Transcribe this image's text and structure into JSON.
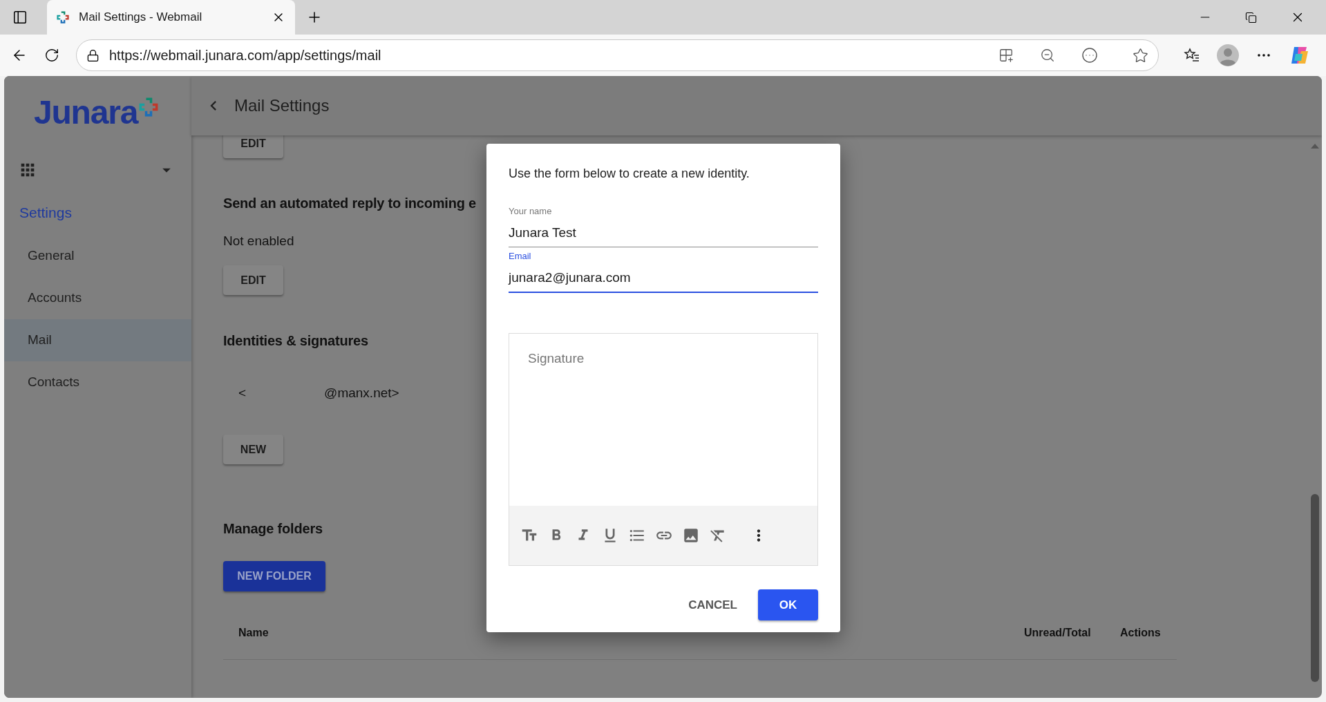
{
  "browser": {
    "tab_title": "Mail Settings - Webmail",
    "url": "https://webmail.junara.com/app/settings/mail"
  },
  "sidebar": {
    "logo": "Junara",
    "section": "Settings",
    "items": [
      {
        "label": "General",
        "selected": false
      },
      {
        "label": "Accounts",
        "selected": false
      },
      {
        "label": "Mail",
        "selected": true
      },
      {
        "label": "Contacts",
        "selected": false
      }
    ]
  },
  "header": {
    "title": "Mail Settings"
  },
  "content": {
    "top_button": "EDIT",
    "auto_reply_heading": "Send an automated reply to incoming e",
    "auto_reply_status": "Not enabled",
    "auto_reply_button": "EDIT",
    "identities_heading": "Identities & signatures",
    "identity_open": "<",
    "identity_address": "@manx.net>",
    "new_button": "NEW",
    "folders_heading": "Manage folders",
    "new_folder_button": "NEW FOLDER",
    "table": {
      "columns": [
        "Name",
        "Unread/Total",
        "Actions"
      ]
    }
  },
  "dialog": {
    "intro": "Use the form below to create a new identity.",
    "fields": [
      {
        "label": "Your name",
        "value": "Junara Test",
        "focused": false
      },
      {
        "label": "Email",
        "value": "junara2@junara.com",
        "focused": true
      }
    ],
    "signature": {
      "placeholder": "Signature"
    },
    "buttons": [
      {
        "label": "CANCEL",
        "kind": "text"
      },
      {
        "label": "OK",
        "kind": "primary"
      }
    ]
  }
}
